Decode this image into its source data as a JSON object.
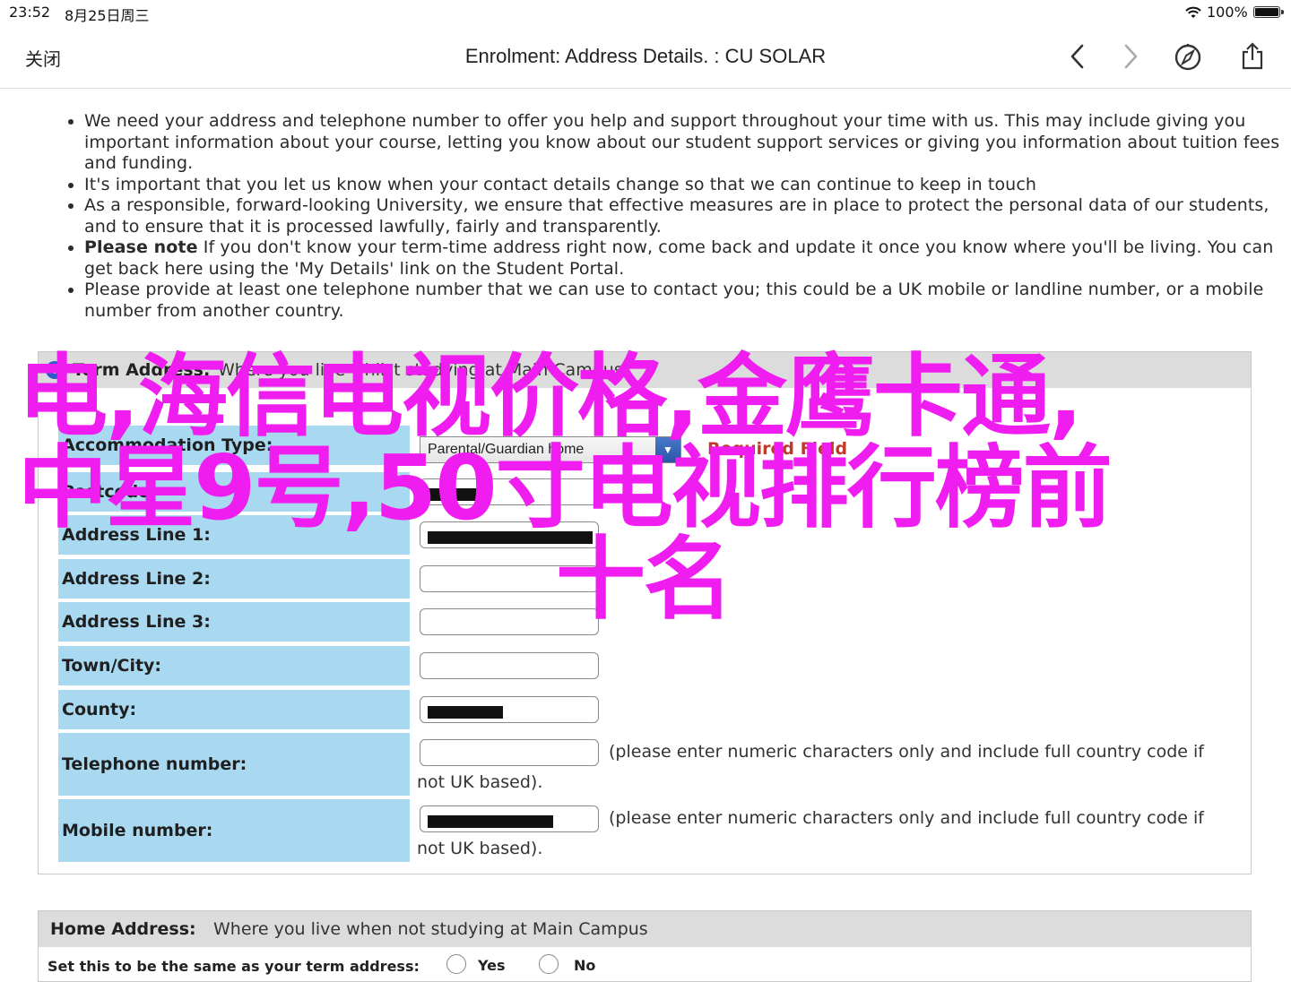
{
  "status_bar": {
    "time": "23:52",
    "date": "8月25日周三",
    "battery_pct": "100%"
  },
  "nav": {
    "close_label": "关闭",
    "title": "Enrolment: Address Details. : CU SOLAR"
  },
  "notes": [
    "We need your address and telephone number to offer you help and support throughout your time with us. This may include giving you important information about your course, letting you know about our student support services or giving you information about tuition fees and funding.",
    "It's important that you let us know when your contact details change so that we can continue to keep in touch",
    "As a responsible, forward-looking University, we ensure that effective measures are in place to protect the personal data of our students, and to ensure that it is processed lawfully, fairly and transparently.",
    {
      "bold": "Please note",
      "text": " If you don't know your term-time address right now, come back and update it once you know where you'll be living. You can get back here using the 'My Details' link on the Student Portal."
    },
    "Please provide at least one telephone number that we can use to contact you; this could be a UK mobile or landline number, or a mobile number from another country."
  ],
  "term_address": {
    "label": "Term Address:",
    "description": "Where you live whilst studying at Main Campus",
    "accommodation_type_label": "Accommodation Type:",
    "accommodation_type_value": "Parental/Guardian home",
    "required_text": "Required Field",
    "postcode_label": "Postcode:",
    "address1_label": "Address Line 1:",
    "address2_label": "Address Line 2:",
    "address3_label": "Address Line 3:",
    "town_label": "Town/City:",
    "county_label": "County:",
    "telephone_label": "Telephone number:",
    "mobile_label": "Mobile number:",
    "phone_hint_line1": "(please enter numeric characters only and include full country code if",
    "phone_hint_line2": "not UK based)."
  },
  "home_address": {
    "label": "Home Address:",
    "description": "Where you live when not studying at Main Campus",
    "same_label": "Set this to be the same as your term address:",
    "yes_label": "Yes",
    "no_label": "No"
  },
  "overlay_text": {
    "line1": "电,海信电视价格,金鹰卡通,",
    "line2": "中星9号,50寸电视排行榜前",
    "line3": "十名"
  },
  "colors": {
    "label_bg": "#a9d8f1",
    "header_bg": "#dcdcdc",
    "overlay": "#f01df0",
    "required": "#c0392b"
  }
}
